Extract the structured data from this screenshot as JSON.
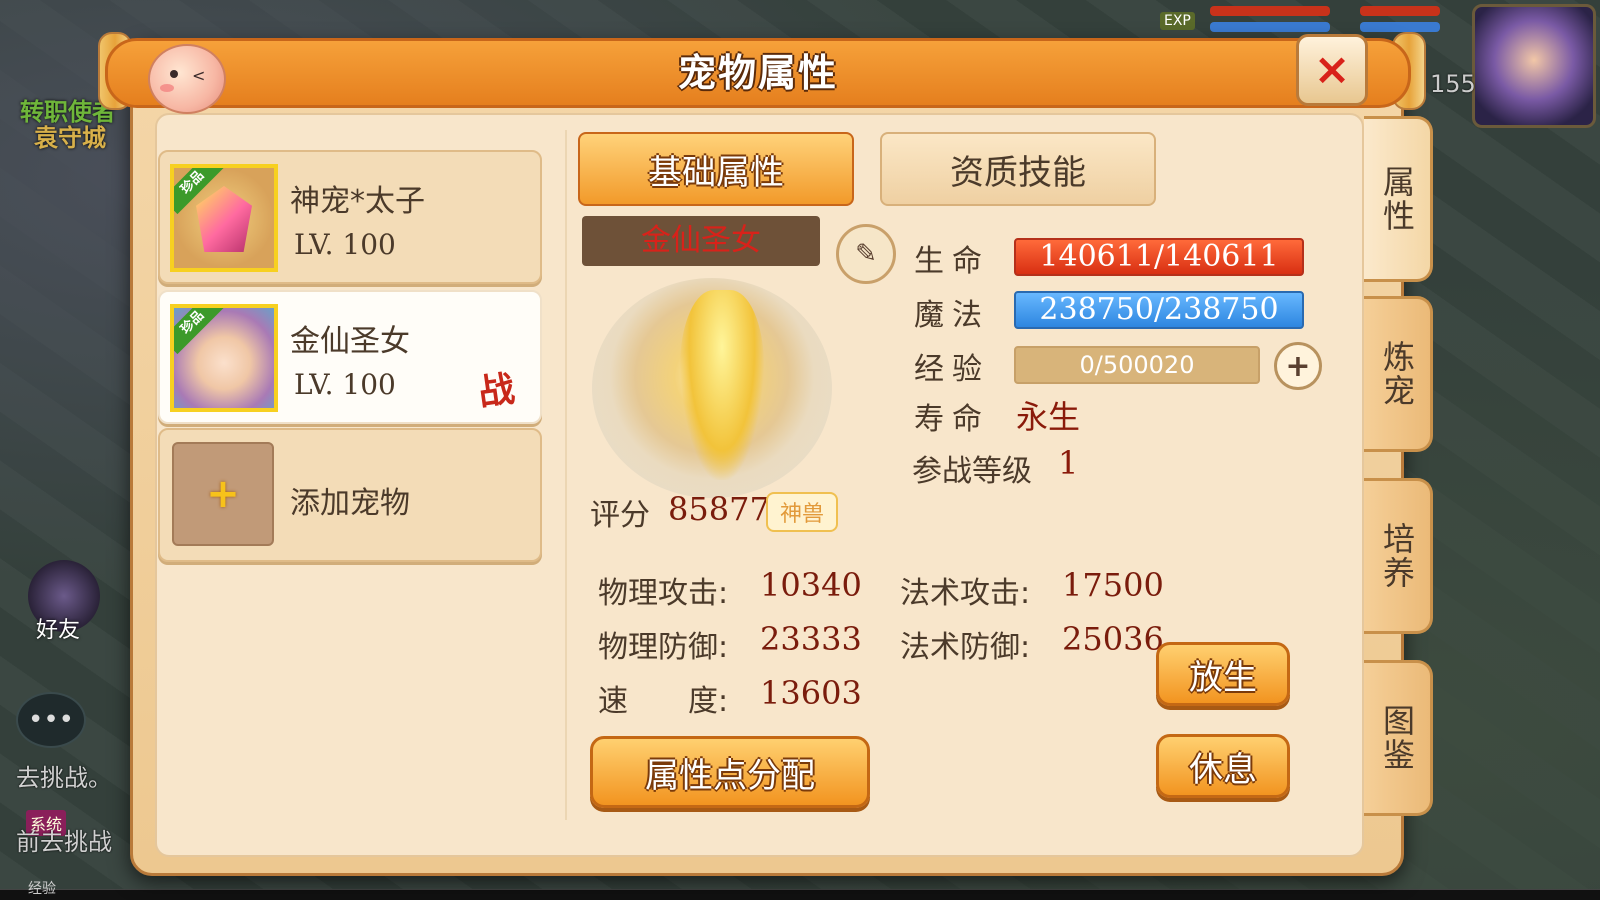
{
  "background": {
    "npc_text": "转职使者",
    "city_text": "袁守城",
    "friend_label": "好友",
    "chat_lines": [
      "去挑战。",
      "前去挑战"
    ],
    "system_tag": "系统",
    "exp_label": "经验",
    "exp_badge": "EXP",
    "player_level": "155"
  },
  "dialog": {
    "title": "宠物属性",
    "close_icon": "×"
  },
  "pet_list": [
    {
      "name": "神宠*太子",
      "level": "LV. 100",
      "rarity": "珍品",
      "icon": "gem-icon",
      "in_battle": false
    },
    {
      "name": "金仙圣女",
      "level": "LV. 100",
      "rarity": "珍品",
      "icon": "goddess-avatar-icon",
      "in_battle": true,
      "battle_mark": "战"
    }
  ],
  "add_pet": {
    "label": "添加宠物",
    "icon": "+"
  },
  "tabs": {
    "basic": "基础属性",
    "aptitude": "资质技能"
  },
  "pet_detail": {
    "name": "金仙圣女",
    "edit_icon": "✎",
    "score_label": "评分",
    "score": "85877",
    "rank_badge": "神兽"
  },
  "stats": {
    "hp_label": "生命",
    "hp_value": "140611/140611",
    "mp_label": "魔法",
    "mp_value": "238750/238750",
    "exp_label": "经验",
    "exp_value": "0/500020",
    "exp_plus": "+",
    "life_label": "寿命",
    "life_value": "永生",
    "battle_level_label": "参战等级",
    "battle_level_value": "1"
  },
  "attributes": {
    "phys_atk_label": "物理攻击:",
    "phys_atk": "10340",
    "magic_atk_label": "法术攻击:",
    "magic_atk": "17500",
    "phys_def_label": "物理防御:",
    "phys_def": "23333",
    "magic_def_label": "法术防御:",
    "magic_def": "25036",
    "speed_label": "速　　度:",
    "speed": "13603"
  },
  "buttons": {
    "allocate": "属性点分配",
    "release": "放生",
    "rest": "休息"
  },
  "side_tabs": [
    "属性",
    "炼宠",
    "培养",
    "图鉴"
  ],
  "colors": {
    "accent_orange": "#f29a2a",
    "hp_red": "#d82f12",
    "mp_blue": "#2d86e0",
    "value_red": "#7a1c0c",
    "close_red": "#d8221a"
  }
}
